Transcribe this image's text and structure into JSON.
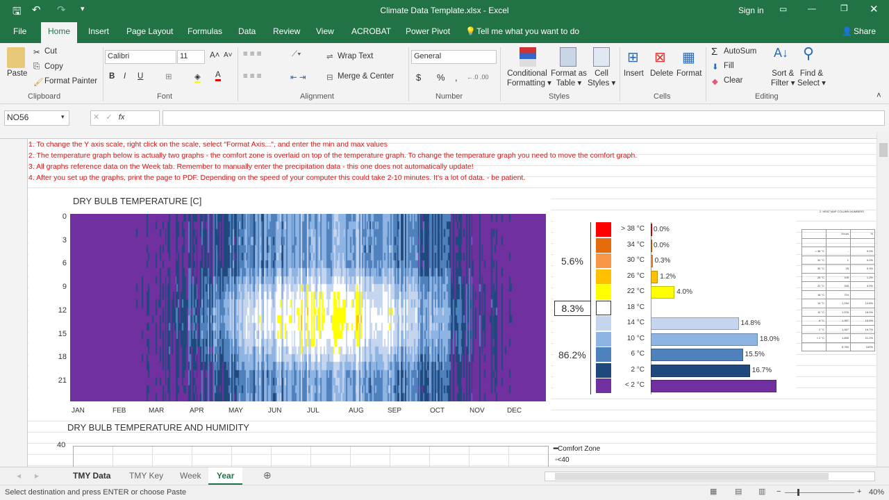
{
  "window": {
    "title": "Climate Data Template.xlsx - Excel",
    "sign_in": "Sign in"
  },
  "ribbon_tabs": [
    "File",
    "Home",
    "Insert",
    "Page Layout",
    "Formulas",
    "Data",
    "Review",
    "View",
    "ACROBAT",
    "Power Pivot"
  ],
  "tell_me": "Tell me what you want to do",
  "share": "Share",
  "clipboard": {
    "paste": "Paste",
    "cut": "Cut",
    "copy": "Copy",
    "format_painter": "Format Painter",
    "group": "Clipboard"
  },
  "font": {
    "name": "Calibri",
    "size": "11",
    "bold": "B",
    "italic": "I",
    "underline": "U",
    "group": "Font"
  },
  "alignment": {
    "wrap": "Wrap Text",
    "merge": "Merge & Center",
    "group": "Alignment"
  },
  "number": {
    "format": "General",
    "currency": "$",
    "percent": "%",
    "comma": ",",
    "group": "Number"
  },
  "styles": {
    "conditional": "Conditional",
    "conditional2": "Formatting",
    "format_table": "Format as",
    "format_table2": "Table",
    "cell_styles": "Cell",
    "cell_styles2": "Styles",
    "group": "Styles"
  },
  "cells": {
    "insert": "Insert",
    "delete": "Delete",
    "format": "Format",
    "group": "Cells"
  },
  "editing": {
    "autosum": "AutoSum",
    "fill": "Fill",
    "clear": "Clear",
    "sort": "Sort &",
    "sort2": "Filter",
    "find": "Find &",
    "find2": "Select",
    "group": "Editing"
  },
  "formula_bar": {
    "name_box": "NO56",
    "value": ""
  },
  "instructions": [
    "1. To change the Y axis scale, right click on the scale, select \"Format Axis...\", and enter the min and max values",
    "2. The temperature graph below is actually two graphs - the comfort zone is overlaid on top of the temperature graph.  To change the temperature graph you need to move the comfort graph.",
    "3. All graphs reference data on the Week tab.  Remember to manually enter the precipitation data - this one does not automatically update!",
    "4. After you set up the graphs, print the page to PDF.  Depending on the speed of your computer this could take 2-10 minutes.  It's a lot of data. - be patient."
  ],
  "chart_data": [
    {
      "type": "heatmap",
      "title": "DRY BULB TEMPERATURE [C]",
      "y_ticks": [
        "0",
        "3",
        "6",
        "9",
        "12",
        "15",
        "18",
        "21"
      ],
      "x_ticks": [
        "JAN",
        "FEB",
        "MAR",
        "APR",
        "MAY",
        "JUN",
        "JUL",
        "AUG",
        "SEP",
        "OCT",
        "NOV",
        "DEC"
      ]
    },
    {
      "type": "bar",
      "orientation": "horizontal",
      "categories": [
        "> 38 °C",
        "34 °C",
        "30 °C",
        "26 °C",
        "22 °C",
        "18 °C",
        "14 °C",
        "10 °C",
        "6 °C",
        "2 °C",
        "< 2 °C"
      ],
      "values": [
        0.0,
        0.0,
        0.3,
        1.2,
        4.0,
        null,
        14.8,
        18.0,
        15.5,
        16.7,
        21.2
      ],
      "labels": [
        "0.0%",
        "0.0%",
        "0.3%",
        "1.2%",
        "4.0%",
        "",
        "14.8%",
        "18.0%",
        "15.5%",
        "16.7%",
        ""
      ],
      "colors": [
        "#ff0000",
        "#e46c0a",
        "#f79646",
        "#ffc000",
        "#ffff00",
        "#ffffff",
        "#c6d5ee",
        "#8eb4e3",
        "#4f81bd",
        "#1f497d",
        "#7030a0"
      ],
      "group_totals": {
        "hot": "5.6%",
        "comfort": "8.3%",
        "cold": "86.2%"
      }
    },
    {
      "type": "line",
      "title": "DRY BULB TEMPERATURE AND HUMIDITY",
      "y_ticks": [
        "40"
      ],
      "legend": [
        "Comfort Zone",
        "<40"
      ],
      "legend_position": "right"
    }
  ],
  "side_table": {
    "title": "2. HEAT MAP COLUMN NUMBERS",
    "rows": [
      [
        "> 38 °C",
        "-",
        "0.0%"
      ],
      [
        "34 °C",
        "1",
        "0.0%"
      ],
      [
        "30 °C",
        "25",
        "0.3%"
      ],
      [
        "26 °C",
        "108",
        "1.2%"
      ],
      [
        "22 °C",
        "345",
        "4.0%"
      ],
      [
        "18 °C",
        "724",
        ""
      ],
      [
        "14 °C",
        "1,294",
        "14.8%"
      ],
      [
        "10 °C",
        "1,576",
        "18.0%"
      ],
      [
        "6 °C",
        "1,357",
        "15.5%"
      ],
      [
        "2 °C",
        "1,467",
        "16.7%"
      ],
      [
        "< 2 °C",
        "1,855",
        "21.2%"
      ],
      [
        "",
        "8,760",
        "100%"
      ]
    ]
  },
  "sheets": [
    "TMY Data",
    "TMY Key",
    "Week",
    "Year"
  ],
  "active_sheet": "Year",
  "status": {
    "message": "Select destination and press ENTER or choose Paste",
    "zoom": "40%"
  }
}
